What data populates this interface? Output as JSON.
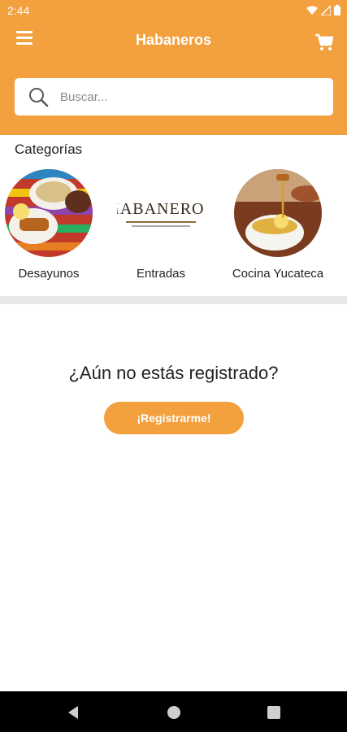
{
  "status_bar": {
    "time": "2:44",
    "icons": [
      "wifi-icon",
      "signal-icon",
      "battery-icon"
    ]
  },
  "app_bar": {
    "title": "Habaneros",
    "menu_icon": "hamburger-icon",
    "cart_icon": "cart-icon"
  },
  "search": {
    "placeholder": "Buscar..."
  },
  "categories": {
    "title": "Categorías",
    "items": [
      {
        "label": "Desayunos"
      },
      {
        "label": "Entradas",
        "logo_text": "HABANEROS"
      },
      {
        "label": "Cocina Yucateca"
      }
    ]
  },
  "register": {
    "question": "¿Aún no estás registrado?",
    "button_label": "¡Registrarme!"
  },
  "nav_bar": {
    "icons": [
      "back-icon",
      "home-icon",
      "recents-icon"
    ]
  },
  "colors": {
    "accent": "#f3a13f",
    "background": "#ffffff",
    "divider": "#e8e8e8"
  }
}
